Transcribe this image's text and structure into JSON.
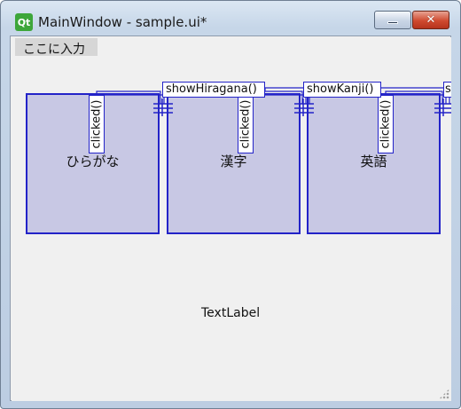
{
  "window": {
    "title": "MainWindow - sample.ui*",
    "logo_text": "Qt",
    "minimize_icon": "minimize-icon",
    "close_icon": "close-icon",
    "close_glyph": "✕"
  },
  "menubar": {
    "items": [
      {
        "label": "ここに入力"
      }
    ]
  },
  "buttons": [
    {
      "label": "ひらがな"
    },
    {
      "label": "漢字"
    },
    {
      "label": "英語"
    }
  ],
  "connections": [
    {
      "signal": "clicked()",
      "slot": "showHiragana()"
    },
    {
      "signal": "clicked()",
      "slot": "showKanji()"
    },
    {
      "signal": "clicked()",
      "slot": "s"
    }
  ],
  "text_label": "TextLabel",
  "colors": {
    "connection_line": "#2323c8",
    "button_fill": "#c8c8e4"
  }
}
